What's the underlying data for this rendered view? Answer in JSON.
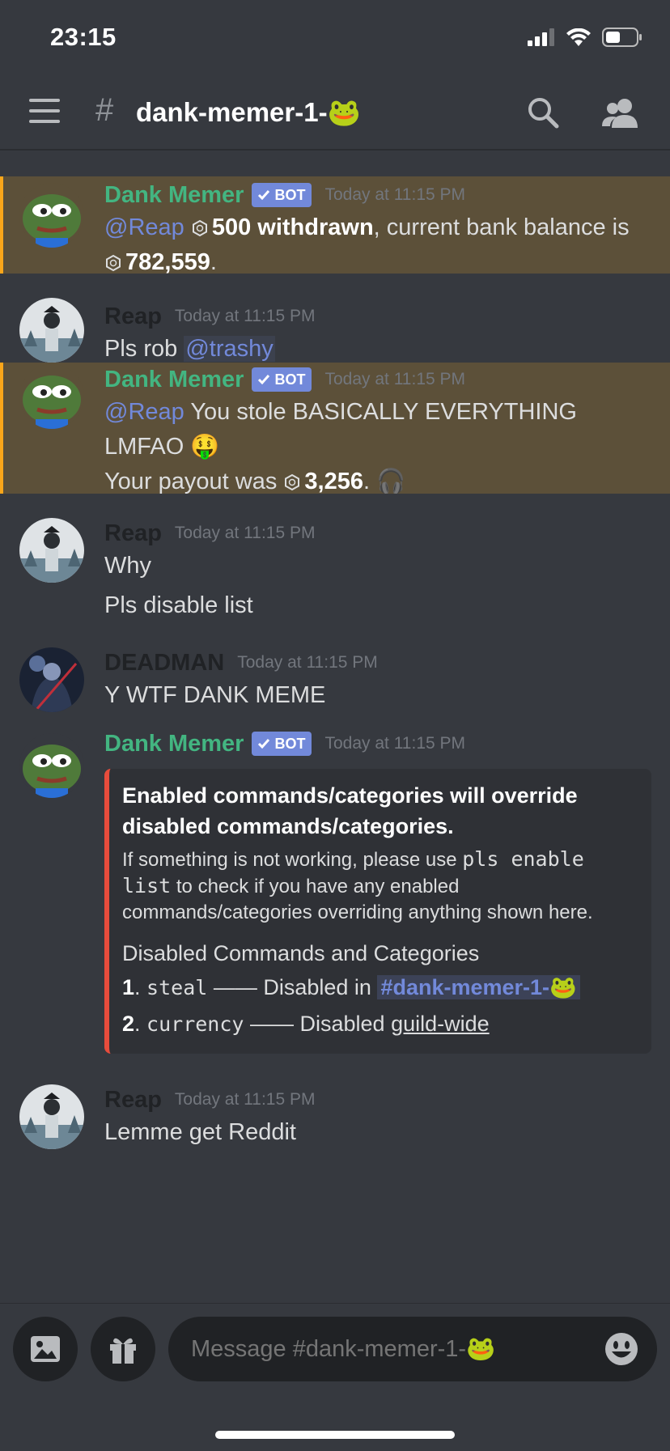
{
  "status": {
    "time": "23:15"
  },
  "header": {
    "hash": "#",
    "channel": "dank-memer-1-🐸"
  },
  "messages": [
    {
      "author": "Dank Memer",
      "bot_tag": "BOT",
      "timestamp": "Today at 11:15 PM",
      "mention": "@Reap",
      "amount": "500 withdrawn",
      "text_mid": ", current bank balance is",
      "balance": "782,559",
      "text_end": "."
    },
    {
      "author": "Reap",
      "timestamp": "Today at 11:15 PM",
      "text": "Pls rob",
      "mention": "@trashy"
    },
    {
      "author": "Dank Memer",
      "bot_tag": "BOT",
      "timestamp": "Today at 11:15 PM",
      "mention": "@Reap",
      "text_1": "You stole BASICALLY EVERYTHING",
      "text_2": "LMFAO 🤑",
      "payout_prefix": "Your payout was",
      "payout": "3,256",
      "payout_suffix": ". 🎧"
    },
    {
      "author": "Reap",
      "timestamp": "Today at 11:15 PM",
      "line_1": "Why",
      "line_2": "Pls disable list"
    },
    {
      "author": "DEADMAN",
      "timestamp": "Today at 11:15 PM",
      "text": "Y WTF DANK MEME"
    },
    {
      "author": "Dank Memer",
      "bot_tag": "BOT",
      "timestamp": "Today at 11:15 PM",
      "embed": {
        "title": "Enabled commands/categories will override disabled commands/categories.",
        "desc_1": "If something is not working, please use",
        "desc_code": "pls enable list",
        "desc_2": "to check if you have any enabled commands/categories overriding anything shown here.",
        "field_name": "Disabled Commands and Categories",
        "rows": [
          {
            "num": "1",
            "cmd": "steal",
            "dash": "——",
            "text": "Disabled in",
            "target": "#dank-memer-1-🐸"
          },
          {
            "num": "2",
            "cmd": "currency",
            "dash": "——",
            "text": "Disabled",
            "target": "guild-wide"
          }
        ]
      }
    },
    {
      "author": "Reap",
      "timestamp": "Today at 11:15 PM",
      "text": "Lemme get Reddit"
    }
  ],
  "input": {
    "placeholder": "Message #dank-memer-1-🐸"
  },
  "colors": {
    "bot_name": "#43b581",
    "mention": "#7289da",
    "highlight_bg": "#5c5039",
    "highlight_border": "#faa61a",
    "embed_border": "#e74c3c"
  }
}
